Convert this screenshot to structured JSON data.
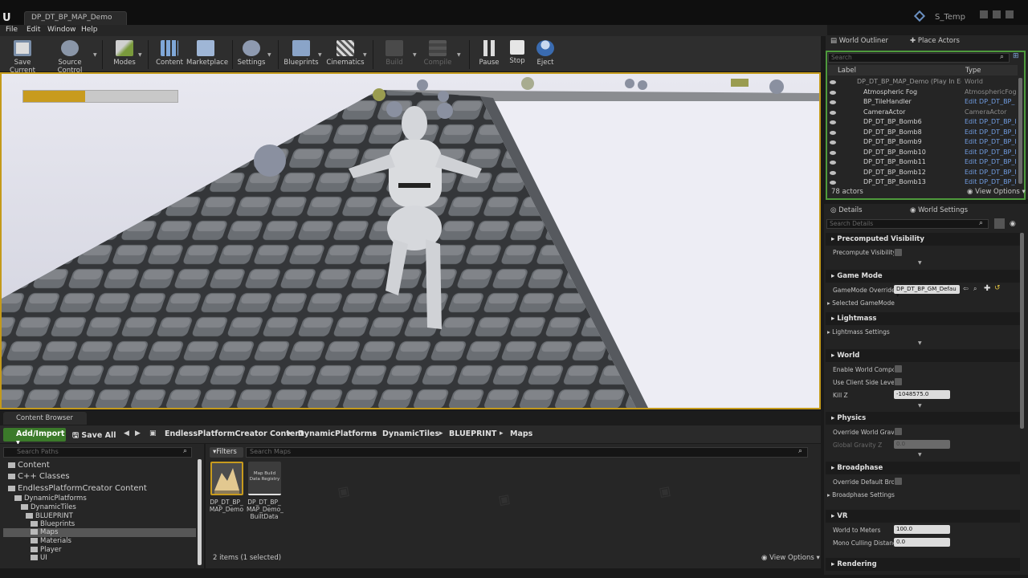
{
  "window": {
    "doc_tab": "DP_DT_BP_MAP_Demo",
    "project": "S_Temp"
  },
  "menu": [
    "File",
    "Edit",
    "Window",
    "Help"
  ],
  "toolbar": {
    "save_current": "Save Current",
    "source_control": "Source Control",
    "modes": "Modes",
    "content": "Content",
    "marketplace": "Marketplace",
    "settings": "Settings",
    "blueprints": "Blueprints",
    "cinematics": "Cinematics",
    "build": "Build",
    "compile": "Compile",
    "pause": "Pause",
    "stop": "Stop",
    "eject": "Eject"
  },
  "viewport": {
    "progress_fraction": 0.4
  },
  "content_browser": {
    "tab": "Content Browser",
    "add_import": "Add/Import",
    "save_all": "Save All",
    "breadcrumb": [
      "EndlessPlatformCreator Content",
      "DynamicPlatforms",
      "DynamicTiles",
      "BLUEPRINT",
      "Maps"
    ],
    "search_paths_placeholder": "Search Paths",
    "search_maps_placeholder": "Search Maps",
    "filters": "Filters",
    "tree": [
      "Content",
      "C++ Classes",
      "EndlessPlatformCreator Content",
      "DynamicPlatforms",
      "DynamicTiles",
      "BLUEPRINT",
      "Blueprints",
      "Maps",
      "Materials",
      "Player",
      "UI"
    ],
    "assets": [
      {
        "name": "DP_DT_BP_ MAP_Demo",
        "thumb_text": ""
      },
      {
        "name": "DP_DT_BP_ MAP_Demo_ BuiltData",
        "thumb_text": "Map Build Data Registry"
      }
    ],
    "status": "2 items (1 selected)",
    "view_options": "View Options"
  },
  "world_outliner": {
    "tab": "World Outliner",
    "place_actors": "Place Actors",
    "search_placeholder": "Search",
    "col_label": "Label",
    "col_type": "Type",
    "rows": [
      {
        "label": "DP_DT_BP_MAP_Demo (Play In Editor)",
        "type": "World"
      },
      {
        "label": "Atmospheric Fog",
        "type": "AtmosphericFog"
      },
      {
        "label": "BP_TileHandler",
        "type": "Edit DP_DT_BP_"
      },
      {
        "label": "CameraActor",
        "type": "CameraActor"
      },
      {
        "label": "DP_DT_BP_Bomb6",
        "type": "Edit DP_DT_BP_I"
      },
      {
        "label": "DP_DT_BP_Bomb8",
        "type": "Edit DP_DT_BP_I"
      },
      {
        "label": "DP_DT_BP_Bomb9",
        "type": "Edit DP_DT_BP_I"
      },
      {
        "label": "DP_DT_BP_Bomb10",
        "type": "Edit DP_DT_BP_I"
      },
      {
        "label": "DP_DT_BP_Bomb11",
        "type": "Edit DP_DT_BP_I"
      },
      {
        "label": "DP_DT_BP_Bomb12",
        "type": "Edit DP_DT_BP_I"
      },
      {
        "label": "DP_DT_BP_Bomb13",
        "type": "Edit DP_DT_BP_I"
      }
    ],
    "actor_count": "78 actors",
    "view_options": "View Options"
  },
  "details": {
    "tab": "Details",
    "world_settings_tab": "World Settings",
    "search_placeholder": "Search Details",
    "precomputed_visibility": "Precomputed Visibility",
    "precompute_visibility": "Precompute Visibility",
    "game_mode": "Game Mode",
    "gamemode_override": "GameMode Override",
    "gamemode_value": "DP_DT_BP_GM_Defau",
    "selected_gamemode": "Selected GameMode",
    "lightmass": "Lightmass",
    "lightmass_settings": "Lightmass Settings",
    "world": "World",
    "enable_world_composition": "Enable World Composi",
    "use_client_side_level": "Use Client Side Level S",
    "kill_z": "Kill Z",
    "kill_z_value": "-1048575.0",
    "physics": "Physics",
    "override_world_gravity": "Override World Gravity",
    "global_gravity_z": "Global Gravity Z",
    "global_gravity_value": "0.0",
    "broadphase": "Broadphase",
    "override_default_broadphase": "Override Default Broad",
    "broadphase_settings": "Broadphase Settings",
    "vr": "VR",
    "world_to_meters": "World to Meters",
    "world_to_meters_value": "100.0",
    "mono_culling_distance": "Mono Culling Distance",
    "mono_culling_value": "0.0",
    "rendering": "Rendering"
  },
  "colors": {
    "accent_gold": "#c89b1e",
    "outliner_border": "#4e9a3c",
    "add_import_green": "#3b7a2a",
    "link_blue": "#6f9be0"
  }
}
